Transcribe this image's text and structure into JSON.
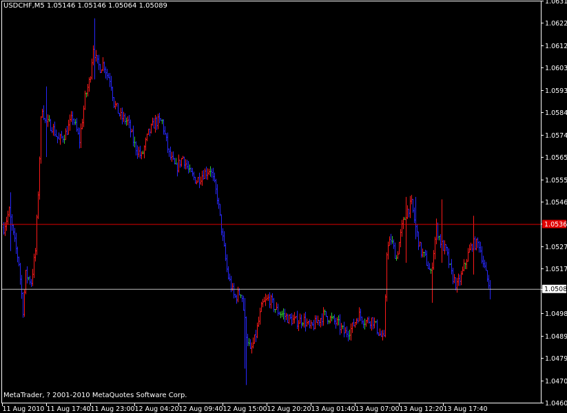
{
  "header": {
    "title": "USDCHF,M5  1.05146 1.05146 1.05064 1.05089"
  },
  "footer": {
    "copyright": "MetaTrader, ? 2001-2010 MetaQuotes Software Corp."
  },
  "colors": {
    "background": "#000000",
    "axis": "#ffffff",
    "up_bar": "#ff1a1a",
    "down_bar": "#2828ff",
    "doji_bar": "#33cc33",
    "ask_line": "#e00000",
    "bid_line": "#c0c0c0"
  },
  "chart_data": {
    "type": "ohlc",
    "symbol": "USDCHF",
    "timeframe": "M5",
    "ylim": [
      1.04605,
      1.06315
    ],
    "y_ticks": [
      "1.06315",
      "1.06220",
      "1.06125",
      "1.06030",
      "1.05935",
      "1.05840",
      "1.05745",
      "1.05650",
      "1.05555",
      "1.05460",
      "1.05365",
      "1.05270",
      "1.05175",
      "1.05089",
      "1.04985",
      "1.04890",
      "1.04795",
      "1.04700",
      "1.04605"
    ],
    "x_ticks": [
      "11 Aug 2010",
      "11 Aug 17:40",
      "11 Aug 23:00",
      "12 Aug 04:20",
      "12 Aug 09:40",
      "12 Aug 15:00",
      "12 Aug 20:20",
      "13 Aug 01:40",
      "13 Aug 07:00",
      "13 Aug 12:20",
      "13 Aug 17:40"
    ],
    "bid_price": 1.05089,
    "ask_price": 1.05365,
    "bid_label": "1.05089",
    "ask_label": "1.05365",
    "path_points": [
      [
        0,
        1.0535
      ],
      [
        8,
        1.0542
      ],
      [
        15,
        1.053
      ],
      [
        22,
        1.052
      ],
      [
        28,
        1.05
      ],
      [
        32,
        1.0515
      ],
      [
        40,
        1.0512
      ],
      [
        46,
        1.0525
      ],
      [
        50,
        1.055
      ],
      [
        52,
        1.0565
      ],
      [
        55,
        1.0588
      ],
      [
        60,
        1.058
      ],
      [
        70,
        1.0578
      ],
      [
        80,
        1.0572
      ],
      [
        90,
        1.0575
      ],
      [
        100,
        1.0582
      ],
      [
        110,
        1.0572
      ],
      [
        118,
        1.059
      ],
      [
        125,
        1.0598
      ],
      [
        130,
        1.0612
      ],
      [
        135,
        1.0605
      ],
      [
        140,
        1.0603
      ],
      [
        145,
        1.0605
      ],
      [
        150,
        1.06
      ],
      [
        155,
        1.0598
      ],
      [
        160,
        1.0588
      ],
      [
        170,
        1.0582
      ],
      [
        180,
        1.058
      ],
      [
        190,
        1.057
      ],
      [
        200,
        1.0565
      ],
      [
        210,
        1.0575
      ],
      [
        220,
        1.058
      ],
      [
        230,
        1.058
      ],
      [
        240,
        1.0566
      ],
      [
        250,
        1.056
      ],
      [
        260,
        1.0565
      ],
      [
        270,
        1.0558
      ],
      [
        280,
        1.0555
      ],
      [
        290,
        1.0558
      ],
      [
        300,
        1.056
      ],
      [
        310,
        1.0548
      ],
      [
        318,
        1.053
      ],
      [
        325,
        1.0515
      ],
      [
        335,
        1.0505
      ],
      [
        345,
        1.0508
      ],
      [
        352,
        1.049
      ],
      [
        358,
        1.0482
      ],
      [
        365,
        1.0488
      ],
      [
        375,
        1.0502
      ],
      [
        385,
        1.0505
      ],
      [
        395,
        1.05
      ],
      [
        405,
        1.0498
      ],
      [
        415,
        1.0496
      ],
      [
        425,
        1.0495
      ],
      [
        435,
        1.0496
      ],
      [
        445,
        1.0492
      ],
      [
        455,
        1.0495
      ],
      [
        465,
        1.0498
      ],
      [
        475,
        1.0496
      ],
      [
        485,
        1.0494
      ],
      [
        495,
        1.049
      ],
      [
        505,
        1.0492
      ],
      [
        515,
        1.0498
      ],
      [
        525,
        1.0495
      ],
      [
        535,
        1.0496
      ],
      [
        545,
        1.049
      ],
      [
        552,
        1.0487
      ],
      [
        556,
        1.0525
      ],
      [
        562,
        1.053
      ],
      [
        570,
        1.0522
      ],
      [
        578,
        1.0535
      ],
      [
        585,
        1.0542
      ],
      [
        592,
        1.0545
      ],
      [
        598,
        1.0535
      ],
      [
        605,
        1.0525
      ],
      [
        612,
        1.0522
      ],
      [
        620,
        1.0515
      ],
      [
        628,
        1.0535
      ],
      [
        635,
        1.0528
      ],
      [
        642,
        1.0525
      ],
      [
        650,
        1.0515
      ],
      [
        658,
        1.051
      ],
      [
        665,
        1.0515
      ],
      [
        672,
        1.0522
      ],
      [
        680,
        1.0528
      ],
      [
        690,
        1.0528
      ],
      [
        700,
        1.0515
      ],
      [
        706,
        1.05089
      ]
    ],
    "spikes": [
      [
        10,
        1.055,
        1.0525
      ],
      [
        30,
        1.0507,
        1.0497
      ],
      [
        62,
        1.0595,
        1.0565
      ],
      [
        133,
        1.0624,
        1.0598
      ],
      [
        350,
        1.0505,
        1.0475
      ],
      [
        353,
        1.0478,
        1.0468
      ],
      [
        585,
        1.0548,
        1.052
      ],
      [
        598,
        1.0548,
        1.053
      ],
      [
        622,
        1.0515,
        1.0503
      ],
      [
        637,
        1.0547,
        1.052
      ],
      [
        682,
        1.054,
        1.0515
      ]
    ]
  }
}
